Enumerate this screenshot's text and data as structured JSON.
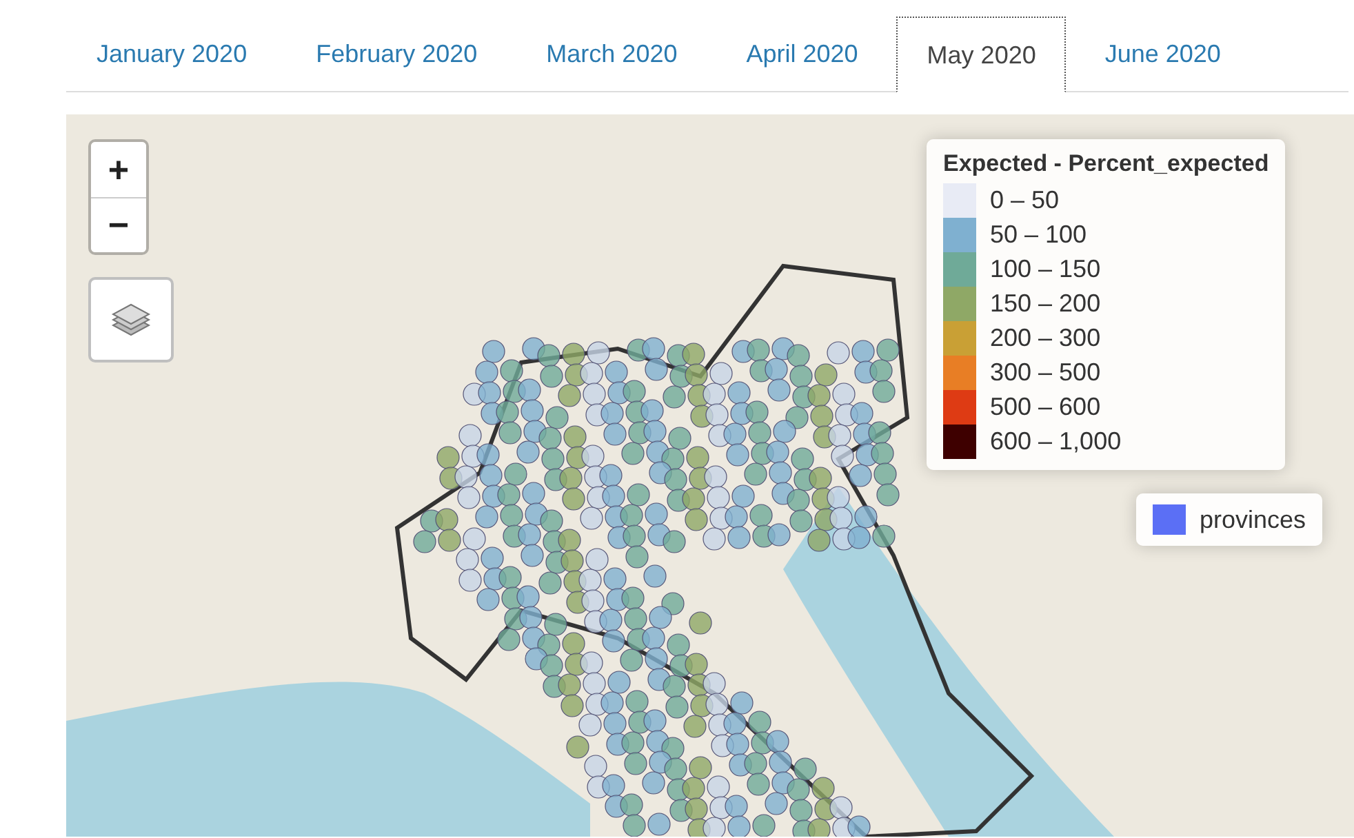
{
  "tabs": [
    {
      "label": "January 2020",
      "selected": false
    },
    {
      "label": "February 2020",
      "selected": false
    },
    {
      "label": "March 2020",
      "selected": false
    },
    {
      "label": "April 2020",
      "selected": false
    },
    {
      "label": "May 2020",
      "selected": true
    },
    {
      "label": "June 2020",
      "selected": false
    }
  ],
  "map": {
    "zoom_in": "+",
    "zoom_out": "−",
    "legend": {
      "title": "Expected - Percent_expected",
      "items": [
        {
          "label": "0 – 50",
          "color": "#e8ebf5"
        },
        {
          "label": "50 – 100",
          "color": "#7fb0d0"
        },
        {
          "label": "100 – 150",
          "color": "#6faa98"
        },
        {
          "label": "150 – 200",
          "color": "#8fa866"
        },
        {
          "label": "200 – 300",
          "color": "#c9a035"
        },
        {
          "label": "300 – 500",
          "color": "#e87e25"
        },
        {
          "label": "500 – 600",
          "color": "#de3b14"
        },
        {
          "label": "600 – 1,000",
          "color": "#3e0000"
        }
      ]
    },
    "overlay": {
      "label": "provinces",
      "color": "#5b6ff5"
    }
  }
}
